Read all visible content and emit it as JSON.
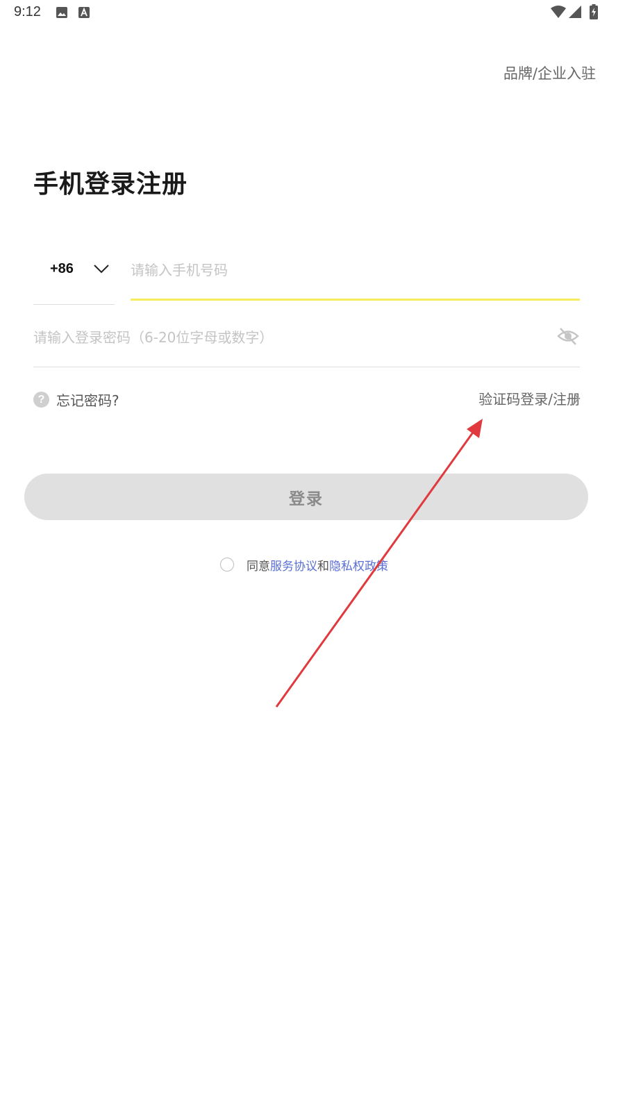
{
  "status_bar": {
    "time": "9:12",
    "left_icons": [
      "image-icon",
      "text-a-icon"
    ],
    "right_icons": [
      "wifi-icon",
      "signal-icon",
      "battery-charging-icon"
    ]
  },
  "header": {
    "enterprise_link": "品牌/企业入驻"
  },
  "page_title": "手机登录注册",
  "phone": {
    "country_code": "+86",
    "placeholder": "请输入手机号码",
    "value": "",
    "focus_color": "#f9ec5a"
  },
  "password": {
    "placeholder": "请输入登录密码（6-20位字母或数字）",
    "value": "",
    "toggle_icon": "eye-off-icon"
  },
  "forgot": {
    "label": "忘记密码?",
    "icon_glyph": "?"
  },
  "sms_login": {
    "label": "验证码登录/注册"
  },
  "login_button": {
    "label": "登录",
    "background": "#e0e0e0"
  },
  "agreement": {
    "prefix": "同意",
    "service_link": "服务协议",
    "conjunction": "和",
    "privacy_link": "隐私权政策",
    "checked": false,
    "link_color": "#5a6fd6"
  },
  "annotation": {
    "arrow_color": "#e0393e"
  }
}
